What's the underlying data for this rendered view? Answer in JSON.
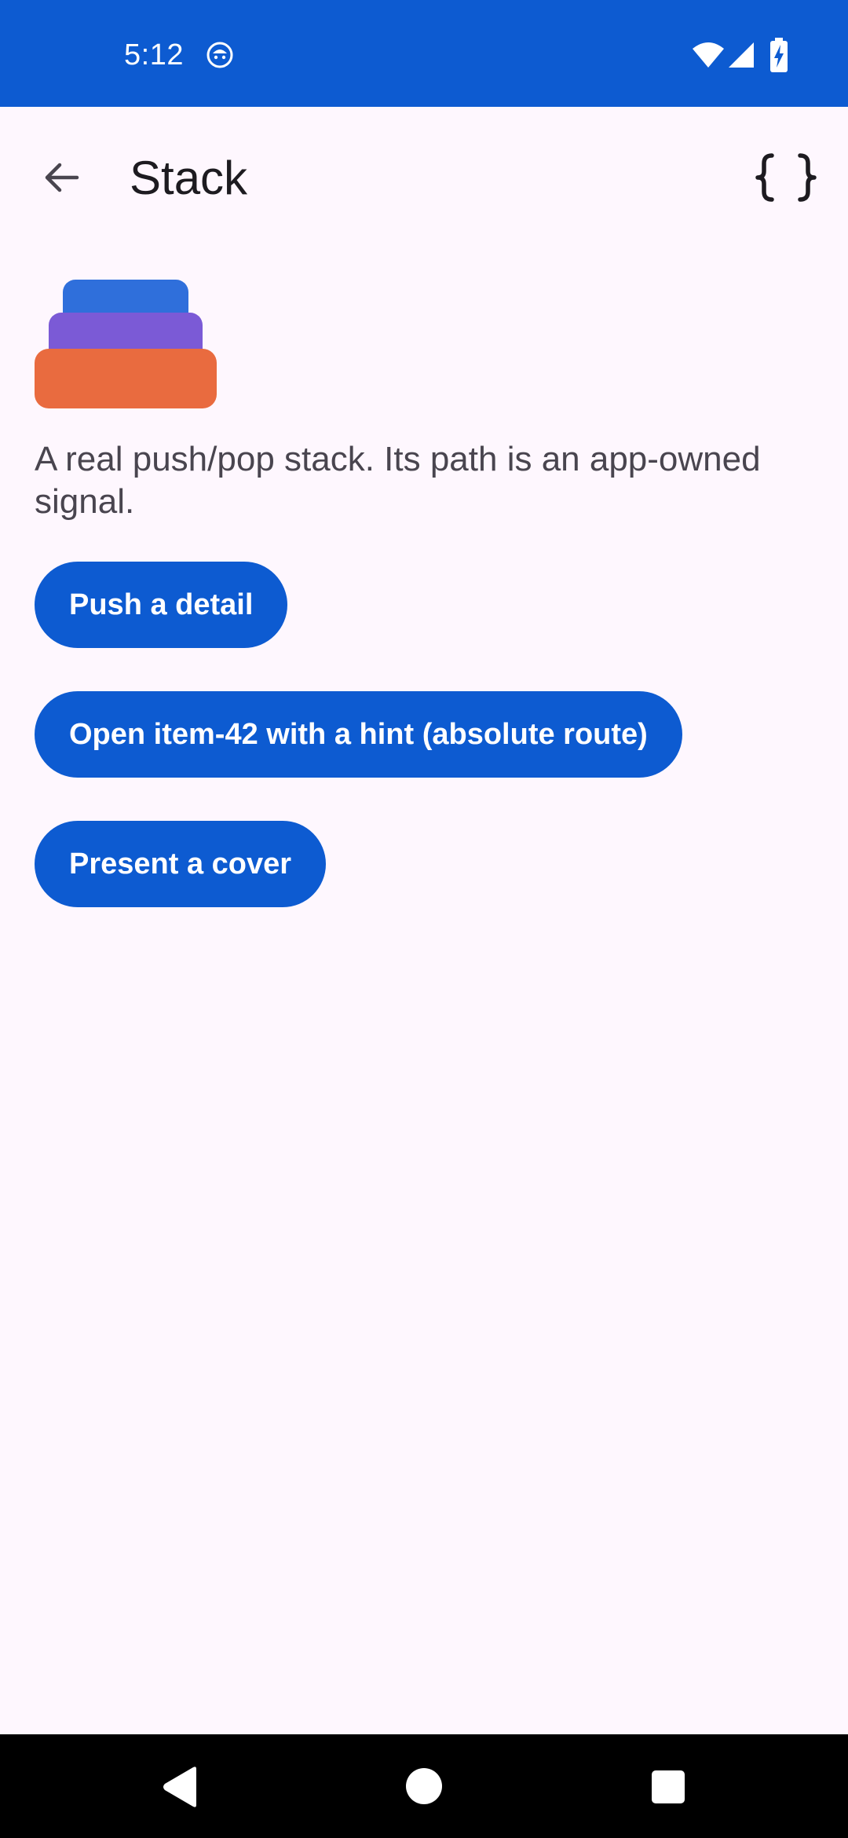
{
  "status_bar": {
    "time": "5:12",
    "background_color": "#0D5BD1",
    "icons": [
      "face-icon",
      "wifi-icon",
      "signal-icon",
      "battery-charging-icon"
    ]
  },
  "app_bar": {
    "title": "Stack",
    "back_icon": "arrow-left-icon",
    "action_icon": "curly-braces-icon"
  },
  "content": {
    "illustration": {
      "icon": "stack-layers-icon",
      "colors": [
        "#2F6FDB",
        "#7B5AD6",
        "#E96B3F"
      ]
    },
    "description": "A real push/pop stack. Its path is an app-owned signal.",
    "buttons": [
      {
        "label": "Push a detail"
      },
      {
        "label": "Open item-42 with a hint (absolute route)"
      },
      {
        "label": "Present a cover"
      }
    ],
    "accent_color": "#0D5BD1"
  },
  "nav_bar": {
    "icons": [
      "nav-back-icon",
      "nav-home-icon",
      "nav-recents-icon"
    ]
  }
}
